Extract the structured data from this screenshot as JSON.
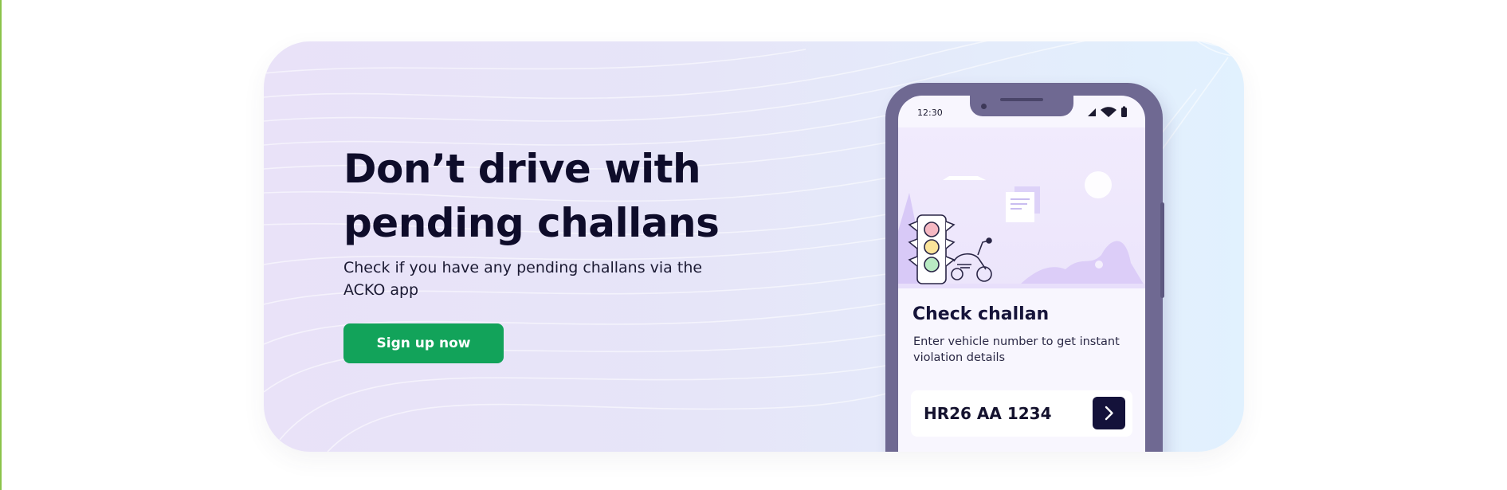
{
  "banner": {
    "headline": "Don’t drive with pending challans",
    "subtext": "Check if you have any pending challans via the ACKO app",
    "cta_label": "Sign up now",
    "colors": {
      "cta": "#12a35a",
      "headline": "#0e0c2a",
      "phone_frame": "#6f6992"
    }
  },
  "phone": {
    "status_time": "12:30",
    "status_icons": [
      "signal-icon",
      "wifi-icon",
      "battery-icon"
    ],
    "card": {
      "title": "Check challan",
      "description": "Enter vehicle number to get instant violation details",
      "vehicle_number": "HR26 AA 1234",
      "submit_icon": "chevron-right-icon"
    }
  }
}
